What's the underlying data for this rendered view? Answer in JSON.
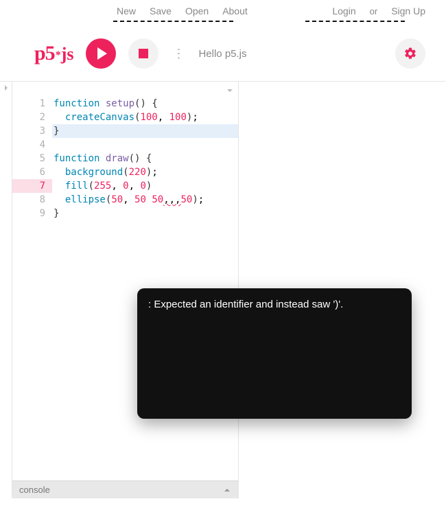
{
  "nav": {
    "new": "New",
    "save": "Save",
    "open": "Open",
    "about": "About",
    "login": "Login",
    "or": "or",
    "signup": "Sign Up"
  },
  "logo": {
    "prefix": "p5",
    "star": "*",
    "suffix": "js"
  },
  "toolbar": {
    "sketch_name": "Hello p5.js"
  },
  "code": {
    "lines": [
      {
        "n": 1,
        "tokens": [
          [
            "kw",
            "function"
          ],
          [
            "txt",
            " "
          ],
          [
            "ident",
            "setup"
          ],
          [
            "paren",
            "()"
          ],
          [
            "txt",
            " "
          ],
          [
            "brace",
            "{"
          ]
        ]
      },
      {
        "n": 2,
        "tokens": [
          [
            "txt",
            "  "
          ],
          [
            "method",
            "createCanvas"
          ],
          [
            "paren",
            "("
          ],
          [
            "num",
            "100"
          ],
          [
            "txt",
            ", "
          ],
          [
            "num",
            "100"
          ],
          [
            "paren",
            ")"
          ],
          [
            "txt",
            ";"
          ]
        ]
      },
      {
        "n": 3,
        "hl": true,
        "tokens": [
          [
            "brace",
            "}"
          ]
        ]
      },
      {
        "n": 4,
        "tokens": []
      },
      {
        "n": 5,
        "tokens": [
          [
            "kw",
            "function"
          ],
          [
            "txt",
            " "
          ],
          [
            "ident",
            "draw"
          ],
          [
            "paren",
            "()"
          ],
          [
            "txt",
            " "
          ],
          [
            "brace",
            "{"
          ]
        ]
      },
      {
        "n": 6,
        "tokens": [
          [
            "txt",
            "  "
          ],
          [
            "method",
            "background"
          ],
          [
            "paren",
            "("
          ],
          [
            "num",
            "220"
          ],
          [
            "paren",
            ")"
          ],
          [
            "txt",
            ";"
          ]
        ]
      },
      {
        "n": 7,
        "err": true,
        "tokens": [
          [
            "txt",
            "  "
          ],
          [
            "method",
            "fill"
          ],
          [
            "paren",
            "("
          ],
          [
            "num",
            "255"
          ],
          [
            "txt",
            ", "
          ],
          [
            "num",
            "0"
          ],
          [
            "txt",
            ", "
          ],
          [
            "num",
            "0"
          ],
          [
            "paren",
            ")"
          ]
        ]
      },
      {
        "n": 8,
        "tokens": [
          [
            "txt",
            "  "
          ],
          [
            "method",
            "ellipse"
          ],
          [
            "paren",
            "("
          ],
          [
            "num",
            "50"
          ],
          [
            "txt",
            ", "
          ],
          [
            "num",
            "50"
          ],
          [
            "txt",
            " "
          ],
          [
            "num",
            "50"
          ],
          [
            "sq",
            ",,,"
          ],
          [
            "num",
            "50"
          ],
          [
            "paren",
            ")"
          ],
          [
            "txt",
            ";"
          ]
        ]
      },
      {
        "n": 9,
        "tokens": [
          [
            "brace",
            "}"
          ]
        ]
      }
    ]
  },
  "console": {
    "label": "console"
  },
  "tooltip": {
    "text": ": Expected an identifier and instead saw ')'."
  }
}
